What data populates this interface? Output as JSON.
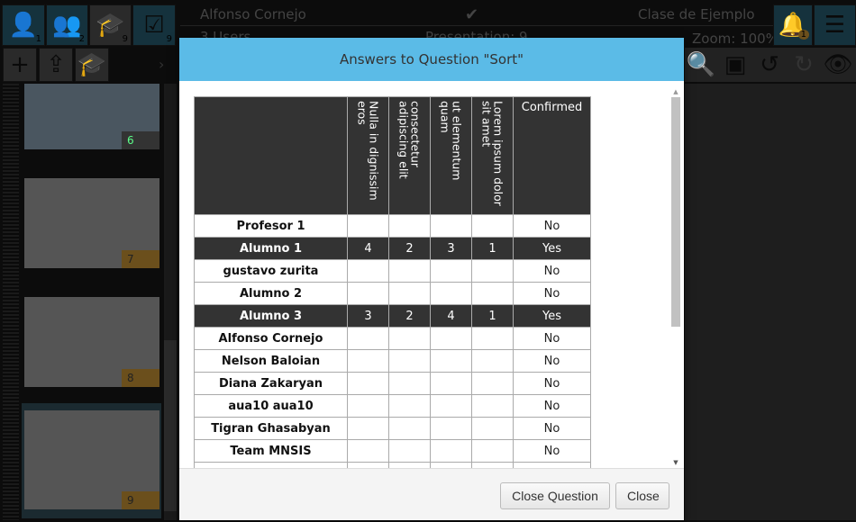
{
  "app": {
    "user_name": "Alfonso Cornejo",
    "users": "3 Users",
    "presentation": "Presentation: 9",
    "class_name": "Clase de Ejemplo",
    "zoom": "Zoom: 100%",
    "counts": {
      "single": "1",
      "group": "2",
      "class": "9",
      "answers": "9",
      "notifications": "1"
    }
  },
  "slides": [
    {
      "num": "6"
    },
    {
      "num": "7"
    },
    {
      "num": "8"
    },
    {
      "num": "9"
    }
  ],
  "modal": {
    "title": "Answers to Question \"Sort\"",
    "columns": [
      "Nulla in dignissim eros",
      "consectetur adipiscing elit",
      "ut elementum quam",
      "Lorem ipsum dolor sit amet",
      "Confirmed"
    ],
    "rows": [
      {
        "name": "Profesor 1",
        "vals": [
          "",
          "",
          "",
          ""
        ],
        "confirmed": "No"
      },
      {
        "name": "Alumno 1",
        "vals": [
          "4",
          "2",
          "3",
          "1"
        ],
        "confirmed": "Yes"
      },
      {
        "name": "gustavo zurita",
        "vals": [
          "",
          "",
          "",
          ""
        ],
        "confirmed": "No"
      },
      {
        "name": "Alumno 2",
        "vals": [
          "",
          "",
          "",
          ""
        ],
        "confirmed": "No"
      },
      {
        "name": "Alumno 3",
        "vals": [
          "3",
          "2",
          "4",
          "1"
        ],
        "confirmed": "Yes"
      },
      {
        "name": "Alfonso Cornejo",
        "vals": [
          "",
          "",
          "",
          ""
        ],
        "confirmed": "No"
      },
      {
        "name": "Nelson Baloian",
        "vals": [
          "",
          "",
          "",
          ""
        ],
        "confirmed": "No"
      },
      {
        "name": "Diana Zakaryan",
        "vals": [
          "",
          "",
          "",
          ""
        ],
        "confirmed": "No"
      },
      {
        "name": "aua10 aua10",
        "vals": [
          "",
          "",
          "",
          ""
        ],
        "confirmed": "No"
      },
      {
        "name": "Tigran Ghasabyan",
        "vals": [
          "",
          "",
          "",
          ""
        ],
        "confirmed": "No"
      },
      {
        "name": "Team MNSIS",
        "vals": [
          "",
          "",
          "",
          ""
        ],
        "confirmed": "No"
      },
      {
        "name": "",
        "vals": [
          "",
          "",
          "",
          ""
        ],
        "confirmed": ""
      }
    ],
    "close_question": "Close Question",
    "close": "Close"
  },
  "colors": {
    "header": "#5bbbe7",
    "highlight_row": "#333333",
    "wrong": "#ff5c5c",
    "correct": "#5cff8a"
  }
}
